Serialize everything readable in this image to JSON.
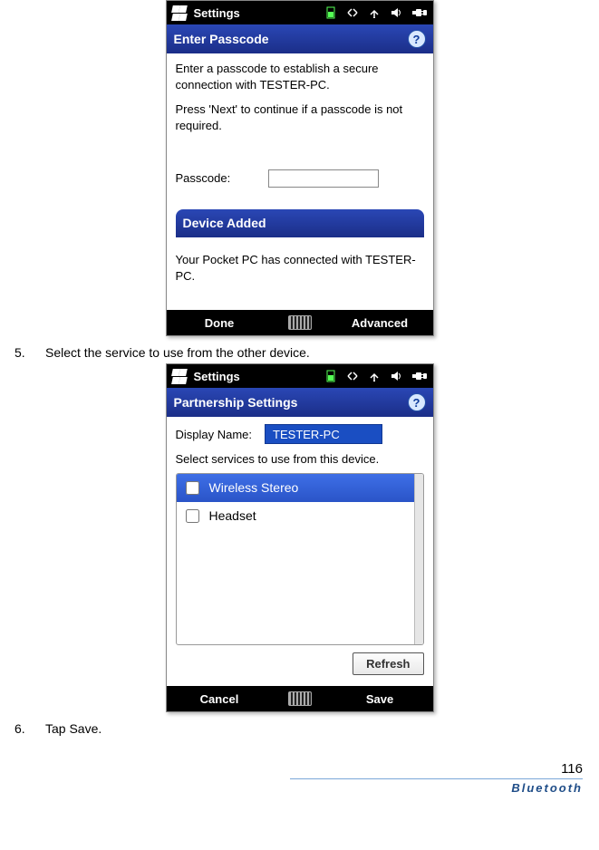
{
  "screenshot1": {
    "status_title": "Settings",
    "titlebar": "Enter Passcode",
    "body1": "Enter a passcode to establish a secure connection with TESTER-PC.",
    "body2": "Press 'Next' to continue if a passcode is not required.",
    "passcode_label": "Passcode:",
    "passcode_value": "",
    "notify_title": "Device Added",
    "notify_text": "Your Pocket PC has connected with TESTER-PC.",
    "soft_left": "Done",
    "soft_right": "Advanced"
  },
  "step5": {
    "num": "5.",
    "text": "Select the service to use from the other device."
  },
  "screenshot2": {
    "status_title": "Settings",
    "titlebar": "Partnership Settings",
    "display_label": "Display Name:",
    "display_value": "TESTER-PC",
    "subtitle": "Select services to use from this device.",
    "services": [
      {
        "label": "Wireless Stereo",
        "checked": false,
        "selected": true
      },
      {
        "label": "Headset",
        "checked": false,
        "selected": false
      }
    ],
    "refresh": "Refresh",
    "soft_left": "Cancel",
    "soft_right": "Save"
  },
  "step6": {
    "num": "6.",
    "text": "Tap Save."
  },
  "footer": {
    "pagenum": "116",
    "section": "Bluetooth"
  }
}
